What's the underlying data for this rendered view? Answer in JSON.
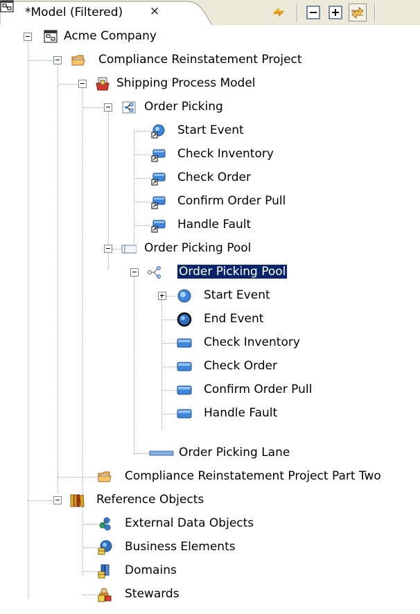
{
  "tab": {
    "title": "*Model (Filtered)",
    "close_symbol": "✕",
    "icon": "model-icon"
  },
  "toolbar": {
    "icons": [
      "sync-arrows-icon",
      "collapse-all-icon",
      "expand-all-icon",
      "link-with-editor-icon"
    ]
  },
  "tree": {
    "acme": "Acme Company",
    "project1": "Compliance Reinstatement  Project",
    "shipping_model": "Shipping Process Model",
    "order_picking": "Order Picking",
    "op_children": [
      "Start Event",
      "Check Inventory",
      "Check Order",
      "Confirm Order Pull",
      "Handle Fault"
    ],
    "pool": "Order Picking Pool",
    "pool_process": "Order Picking Pool",
    "pool_children": [
      "Start Event",
      "End Event",
      "Check Inventory",
      "Check Order",
      "Confirm Order Pull",
      "Handle Fault"
    ],
    "lane": "Order Picking Lane",
    "project2": "Compliance Reinstatement Project Part Two",
    "reference": "Reference Objects",
    "ref_children": [
      "External Data Objects",
      "Business Elements",
      "Domains",
      "Stewards"
    ]
  },
  "colors": {
    "selection": "#0a246a",
    "chrome": "#ece9d8",
    "task_blue": "#3d86d9"
  }
}
